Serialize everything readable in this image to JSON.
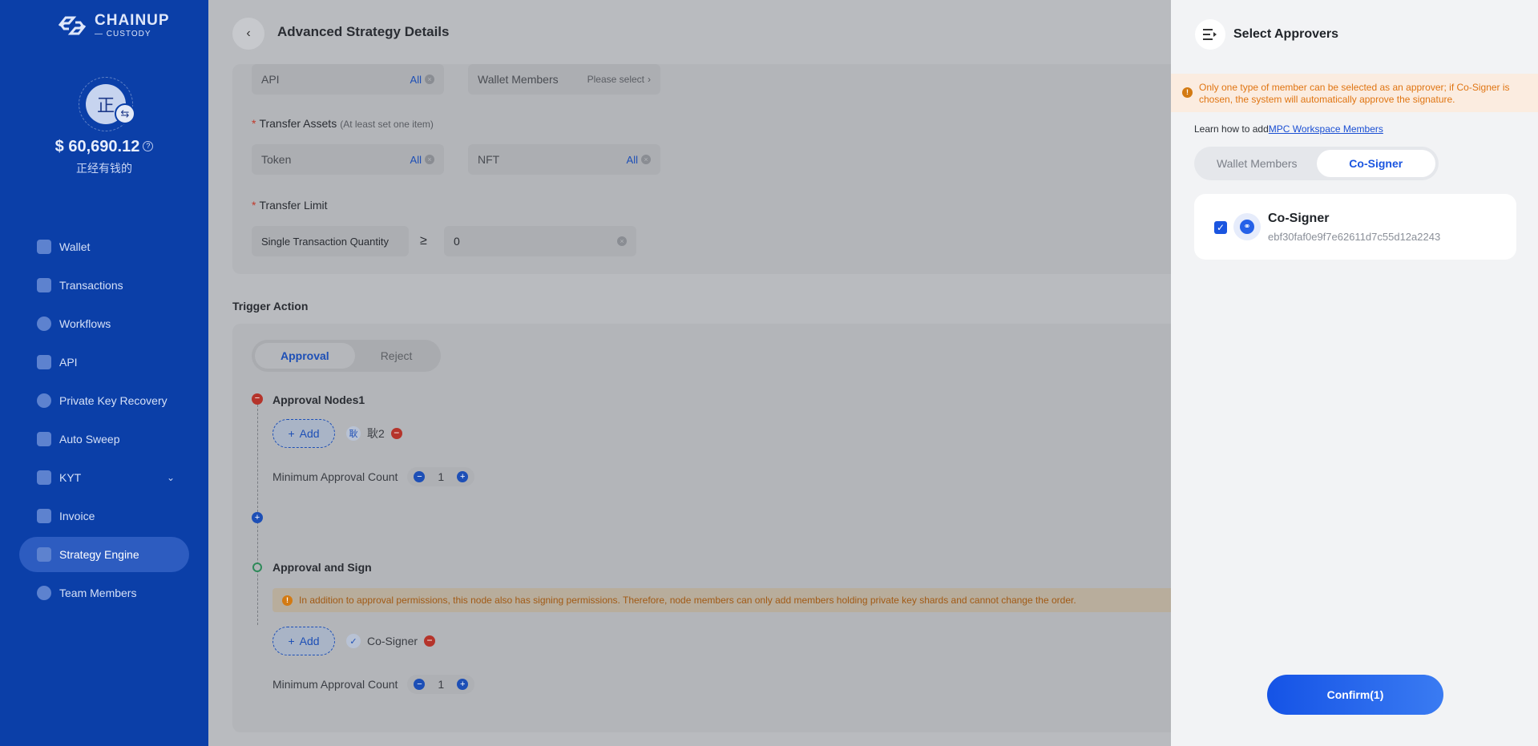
{
  "brand": {
    "name": "CHAINUP",
    "sub": "— CUSTODY"
  },
  "account": {
    "avatar_char": "正",
    "balance": "$ 60,690.12",
    "name": "正经有钱的"
  },
  "nav": [
    {
      "label": "Wallet",
      "icon": "wallet-icon"
    },
    {
      "label": "Transactions",
      "icon": "transactions-icon"
    },
    {
      "label": "Workflows",
      "icon": "workflows-icon"
    },
    {
      "label": "API",
      "icon": "api-icon"
    },
    {
      "label": "Private Key Recovery",
      "icon": "recovery-icon"
    },
    {
      "label": "Auto Sweep",
      "icon": "sweep-icon"
    },
    {
      "label": "KYT",
      "icon": "shield-icon"
    },
    {
      "label": "Invoice",
      "icon": "invoice-icon"
    },
    {
      "label": "Strategy Engine",
      "icon": "strategy-icon",
      "active": true
    },
    {
      "label": "Team Members",
      "icon": "team-icon"
    }
  ],
  "page": {
    "title": "Advanced Strategy Details"
  },
  "filters": {
    "api_label": "API",
    "api_value": "All",
    "wallet_members_label": "Wallet Members",
    "wallet_members_placeholder": "Please select",
    "transfer_assets_label": "Transfer Assets",
    "transfer_assets_hint": "(At least set one item)",
    "token_label": "Token",
    "token_value": "All",
    "nft_label": "NFT",
    "nft_value": "All",
    "transfer_limit_label": "Transfer Limit",
    "limit_type": "Single Transaction Quantity",
    "operator": "≥",
    "limit_value": "0"
  },
  "trigger": {
    "title": "Trigger Action",
    "tabs": [
      "Approval",
      "Reject"
    ],
    "active_tab": "Approval",
    "node1": {
      "title": "Approval Nodes1",
      "add_label": "Add",
      "member_char": "耿",
      "member_name": "耿2",
      "min_count_label": "Minimum Approval Count",
      "min_count": "1"
    },
    "node2": {
      "title": "Approval and Sign",
      "warning": "In addition to approval permissions, this node also has signing permissions. Therefore, node members can only add members holding private key shards and cannot change the order.",
      "add_label": "Add",
      "member_name": "Co-Signer",
      "min_count_label": "Minimum Approval Count",
      "min_count": "1"
    }
  },
  "drawer": {
    "title": "Select Approvers",
    "warning": "Only one type of member can be selected as an approver; if Co-Signer is chosen, the system will automatically approve the signature.",
    "learn_prefix": "Learn how to add",
    "learn_link": "MPC Workspace Members",
    "tabs": [
      "Wallet Members",
      "Co-Signer"
    ],
    "active_tab": "Co-Signer",
    "member": {
      "name": "Co-Signer",
      "id": "ebf30faf0e9f7e62611d7c55d12a2243",
      "checked": true
    },
    "confirm_label": "Confirm(1)"
  },
  "colors": {
    "primary": "#1a55e0",
    "sidebar": "#0b3fa8",
    "warning": "#e07512",
    "danger": "#b5342b"
  }
}
